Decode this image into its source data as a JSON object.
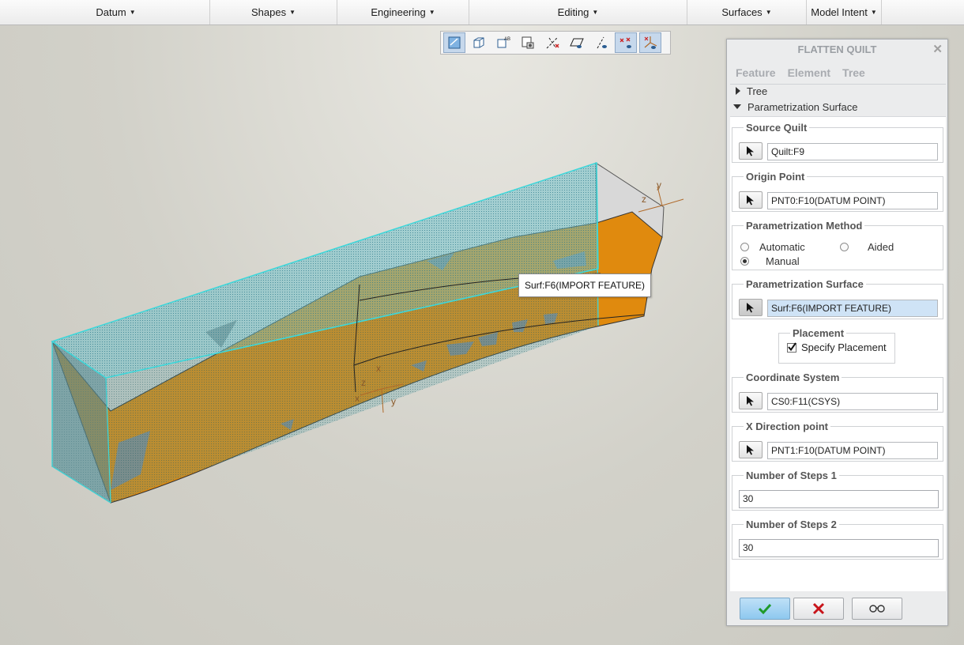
{
  "ribbon": {
    "groups": [
      {
        "label": "Datum"
      },
      {
        "label": "Shapes"
      },
      {
        "label": "Engineering"
      },
      {
        "label": "Editing"
      },
      {
        "label": "Surfaces"
      },
      {
        "label": "Model Intent"
      }
    ]
  },
  "graphics_toolbar": {
    "buttons": [
      {
        "icon": "datum-display-filter-icon",
        "active": true
      },
      {
        "icon": "saved-orientations-icon",
        "active": false
      },
      {
        "icon": "annotation-display-icon",
        "active": false
      },
      {
        "icon": "spin-center-icon",
        "active": false
      },
      {
        "icon": "axis-display-icon",
        "active": false
      },
      {
        "icon": "plane-display-icon",
        "active": false
      },
      {
        "icon": "axis-tag-display-icon",
        "active": false
      },
      {
        "icon": "point-display-icon",
        "active": true
      },
      {
        "icon": "csys-display-icon",
        "active": true
      }
    ]
  },
  "tooltip": {
    "text": "Surf:F6(IMPORT FEATURE)"
  },
  "dialog": {
    "title": "FLATTEN QUILT",
    "tabs": [
      "Feature",
      "Element",
      "Tree"
    ],
    "tree_rows": [
      {
        "label": "Tree",
        "expanded": false
      },
      {
        "label": "Parametrization Surface",
        "expanded": true
      }
    ],
    "source_quilt": {
      "label": "Source Quilt",
      "value": "Quilt:F9"
    },
    "origin_point": {
      "label": "Origin Point",
      "value": "PNT0:F10(DATUM POINT)"
    },
    "parametrization_method": {
      "label": "Parametrization Method",
      "options": [
        "Automatic",
        "Aided",
        "Manual"
      ],
      "selected": "Manual"
    },
    "parametrization_surface": {
      "label": "Parametrization Surface",
      "value": "Surf:F6(IMPORT FEATURE)"
    },
    "placement": {
      "label": "Placement",
      "checkbox_label": "Specify Placement",
      "checked": true
    },
    "coordinate_system": {
      "label": "Coordinate System",
      "value": "CS0:F11(CSYS)"
    },
    "x_direction_point": {
      "label": "X Direction point",
      "value": "PNT1:F10(DATUM POINT)"
    },
    "steps1": {
      "label": "Number of Steps 1",
      "value": "30"
    },
    "steps2": {
      "label": "Number of Steps 2",
      "value": "30"
    }
  },
  "viewport": {
    "axis_labels": {
      "z": "z",
      "y": "y",
      "x": "x"
    }
  },
  "colors": {
    "surface_orange": "#e08a0e",
    "selection_cyan": "#3dd7da",
    "ok_green": "#1f9a2a",
    "cancel_red": "#c8141a"
  }
}
